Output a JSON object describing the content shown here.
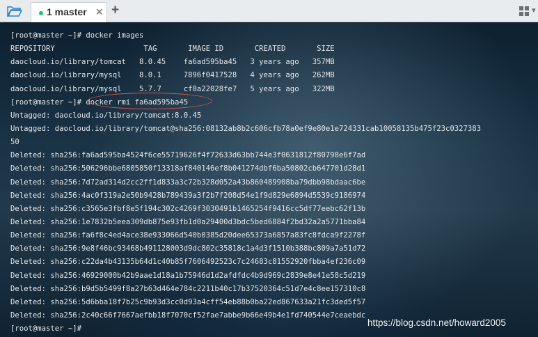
{
  "tabs": [
    {
      "label": "1 master",
      "active": true,
      "status_color": "#21c45d"
    }
  ],
  "toolbar": {
    "close_glyph": "✕",
    "add_glyph": "+",
    "caret_glyph": "▾",
    "icons": [
      "folder-icon",
      "grid-view-icon"
    ]
  },
  "terminal": {
    "lines": [
      "[root@master ~]# docker images",
      "REPOSITORY                    TAG       IMAGE ID       CREATED       SIZE",
      "daocloud.io/library/tomcat   8.0.45    fa6ad595ba45   3 years ago   357MB",
      "daocloud.io/library/mysql    8.0.1     7896f0417528   4 years ago   262MB",
      "daocloud.io/library/mysql    5.7.7     cf8a22028fe7   5 years ago   322MB",
      "[root@master ~]# docker rmi fa6ad595ba45",
      "Untagged: daocloud.io/library/tomcat:8.0.45",
      "Untagged: daocloud.io/library/tomcat@sha256:08132ab8b2c606cfb78a0ef9e80e1e724331cab10058135b475f23c0327383",
      "50",
      "Deleted: sha256:fa6ad595ba4524f6ce55719626f4f72633d63bb744e3f0631812f80798e6f7ad",
      "Deleted: sha256:506296bbe6805850f13318af840146ef8b041274dbf6ba50802cb647701d28d1",
      "Deleted: sha256:7d72ad314d2cc2ff1d833a3c72b328d052a43b860489908ba79dbb98bdaac6be",
      "Deleted: sha256:4ac0f319a2e50b9428b789439a3f2b7f208d54e1f9d829e6894d5539c9186974",
      "Deleted: sha256:c3565e3fbf8e5f194c302c4269f3030491b1465254f9416cc5df77eebc62f13b",
      "Deleted: sha256:1e7832b5eea309db875e93fb1d0a29400d3bdc5bed6884f2bd32a2a5771bba84",
      "Deleted: sha256:fa6f8c4ed4ace38e933066d540b0385d20dee65373a6857a83fc8fdca9f2278f",
      "Deleted: sha256:9e8f46bc93468b491128003d9dc802c35818c1a4d3f1510b388bc809a7a51d72",
      "Deleted: sha256:c22da4b43135b64d1c40b85f7606492523c7c24683c81552920fbba4ef236c09",
      "Deleted: sha256:46929000b42b9aae1d18a1b75946d1d2afdfdc4b9d969c2839e8e41e58c5d219",
      "Deleted: sha256:b9d5b5499f8a27b63d464e784c2211b40c17b37520364c51d7e4c8ee157310c8",
      "Deleted: sha256:5d6bba18f7b25c9b93d3cc0d93a4cff54eb88b0ba22ed867633a21fc3ded5f57",
      "Deleted: sha256:2c40c66f7667aefbb18f7070cf52fae7abbe9b66e49b4e1fd740544e7ceaebdc",
      "[root@master ~]# "
    ]
  },
  "watermark": "https://blog.csdn.net/howard2005"
}
